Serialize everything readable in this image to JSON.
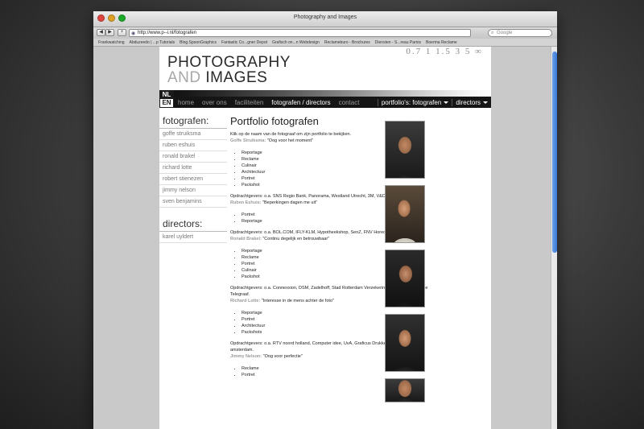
{
  "window": {
    "title": "Photography and Images",
    "url": "http://www.p--i.nl/fotografen",
    "search_placeholder": "Google",
    "nav_back": "◀",
    "nav_forward": "▶",
    "nav_add": "+",
    "bookmarks": [
      "Frankwatching",
      "Abduzeedo | ...p Tutorials",
      "Blog.SpoonGraphics",
      "Fantastic Co...gner Depot",
      "Grafisch on...n Webdesign",
      "Reclameburo - Brochures",
      "Diensten - S...reau Parnis",
      "Boerma Reclame"
    ]
  },
  "header": {
    "logo_line1": "PHOTOGRAPHY",
    "logo_and": "AND",
    "logo_line2": "IMAGES",
    "zoom_numbers": "0.7  1  1.5  3  5  ∞",
    "lang_nl": "NL",
    "lang_en": "EN"
  },
  "nav": {
    "items": [
      "home",
      "over ons",
      "faciliteiten",
      "fotografen / directors",
      "contact"
    ],
    "dropdown_portfolio": "portfolio's: fotografen",
    "dropdown_directors": "directors"
  },
  "sidebar": {
    "fotografen_heading": "fotografen:",
    "fotografen": [
      "goffe struiksma",
      "ruben eshuis",
      "ronald brakel",
      "richard lotte",
      "robert stienezen",
      "jimmy nelson",
      "sven benjamins"
    ],
    "directors_heading": "directors:",
    "directors": [
      "karel uyldert"
    ]
  },
  "content": {
    "title": "Portfolio fotografen",
    "intro": "Klik op de naam van de fotograaf om zijn portfolio te bekijken.",
    "entries": [
      {
        "name": "Goffe Struiksma:",
        "quote": " \"Oog voor het moment\"",
        "skills": [
          "Reportage",
          "Reclame",
          "Culinair",
          "Architectuur",
          "Portret",
          "Packshot"
        ],
        "clients": "Opdrachtgevers: o.a. SNS Regio Bank, Panorama, Westland Utrecht, 3M, V&D La Place."
      },
      {
        "name": "Ruben Eshuis:",
        "quote": " \"Beperkingen dagen me uit\"",
        "skills": [
          "Portret",
          "Reportage"
        ],
        "clients": "Opdrachtgevers: o.a. BOL.COM, IFLY-KLM, Hypotheekshop, SenZ, FNV Horeca."
      },
      {
        "name": "Ronald Brakel:",
        "quote": " \"Continu degelijk en betrouwbaar\"",
        "skills": [
          "Reportage",
          "Reclame",
          "Portret",
          "Culinair",
          "Packshot"
        ],
        "clients": "Opdrachtgevers: o.a. Connexxion, DSM, Zadelhoff, Stad Rotterdam Verzekeringen, AstraZeneca, De Telegraaf."
      },
      {
        "name": "Richard Lotte:",
        "quote": " \"Interesse in de mens achter de foto\"",
        "skills": [
          "Reportage",
          "Portret",
          "Architectuur",
          "Packshots"
        ],
        "clients": "Opdrachtgevers: o.a. RTV noord holland, Computer idee, UvA, Graficus Drukkerij, TPG post amsterdam."
      },
      {
        "name": "Jimmy Nelson:",
        "quote": " \"Oog voor perfectie\"",
        "skills": [
          "Reclame",
          "Portret"
        ],
        "clients": ""
      }
    ]
  }
}
